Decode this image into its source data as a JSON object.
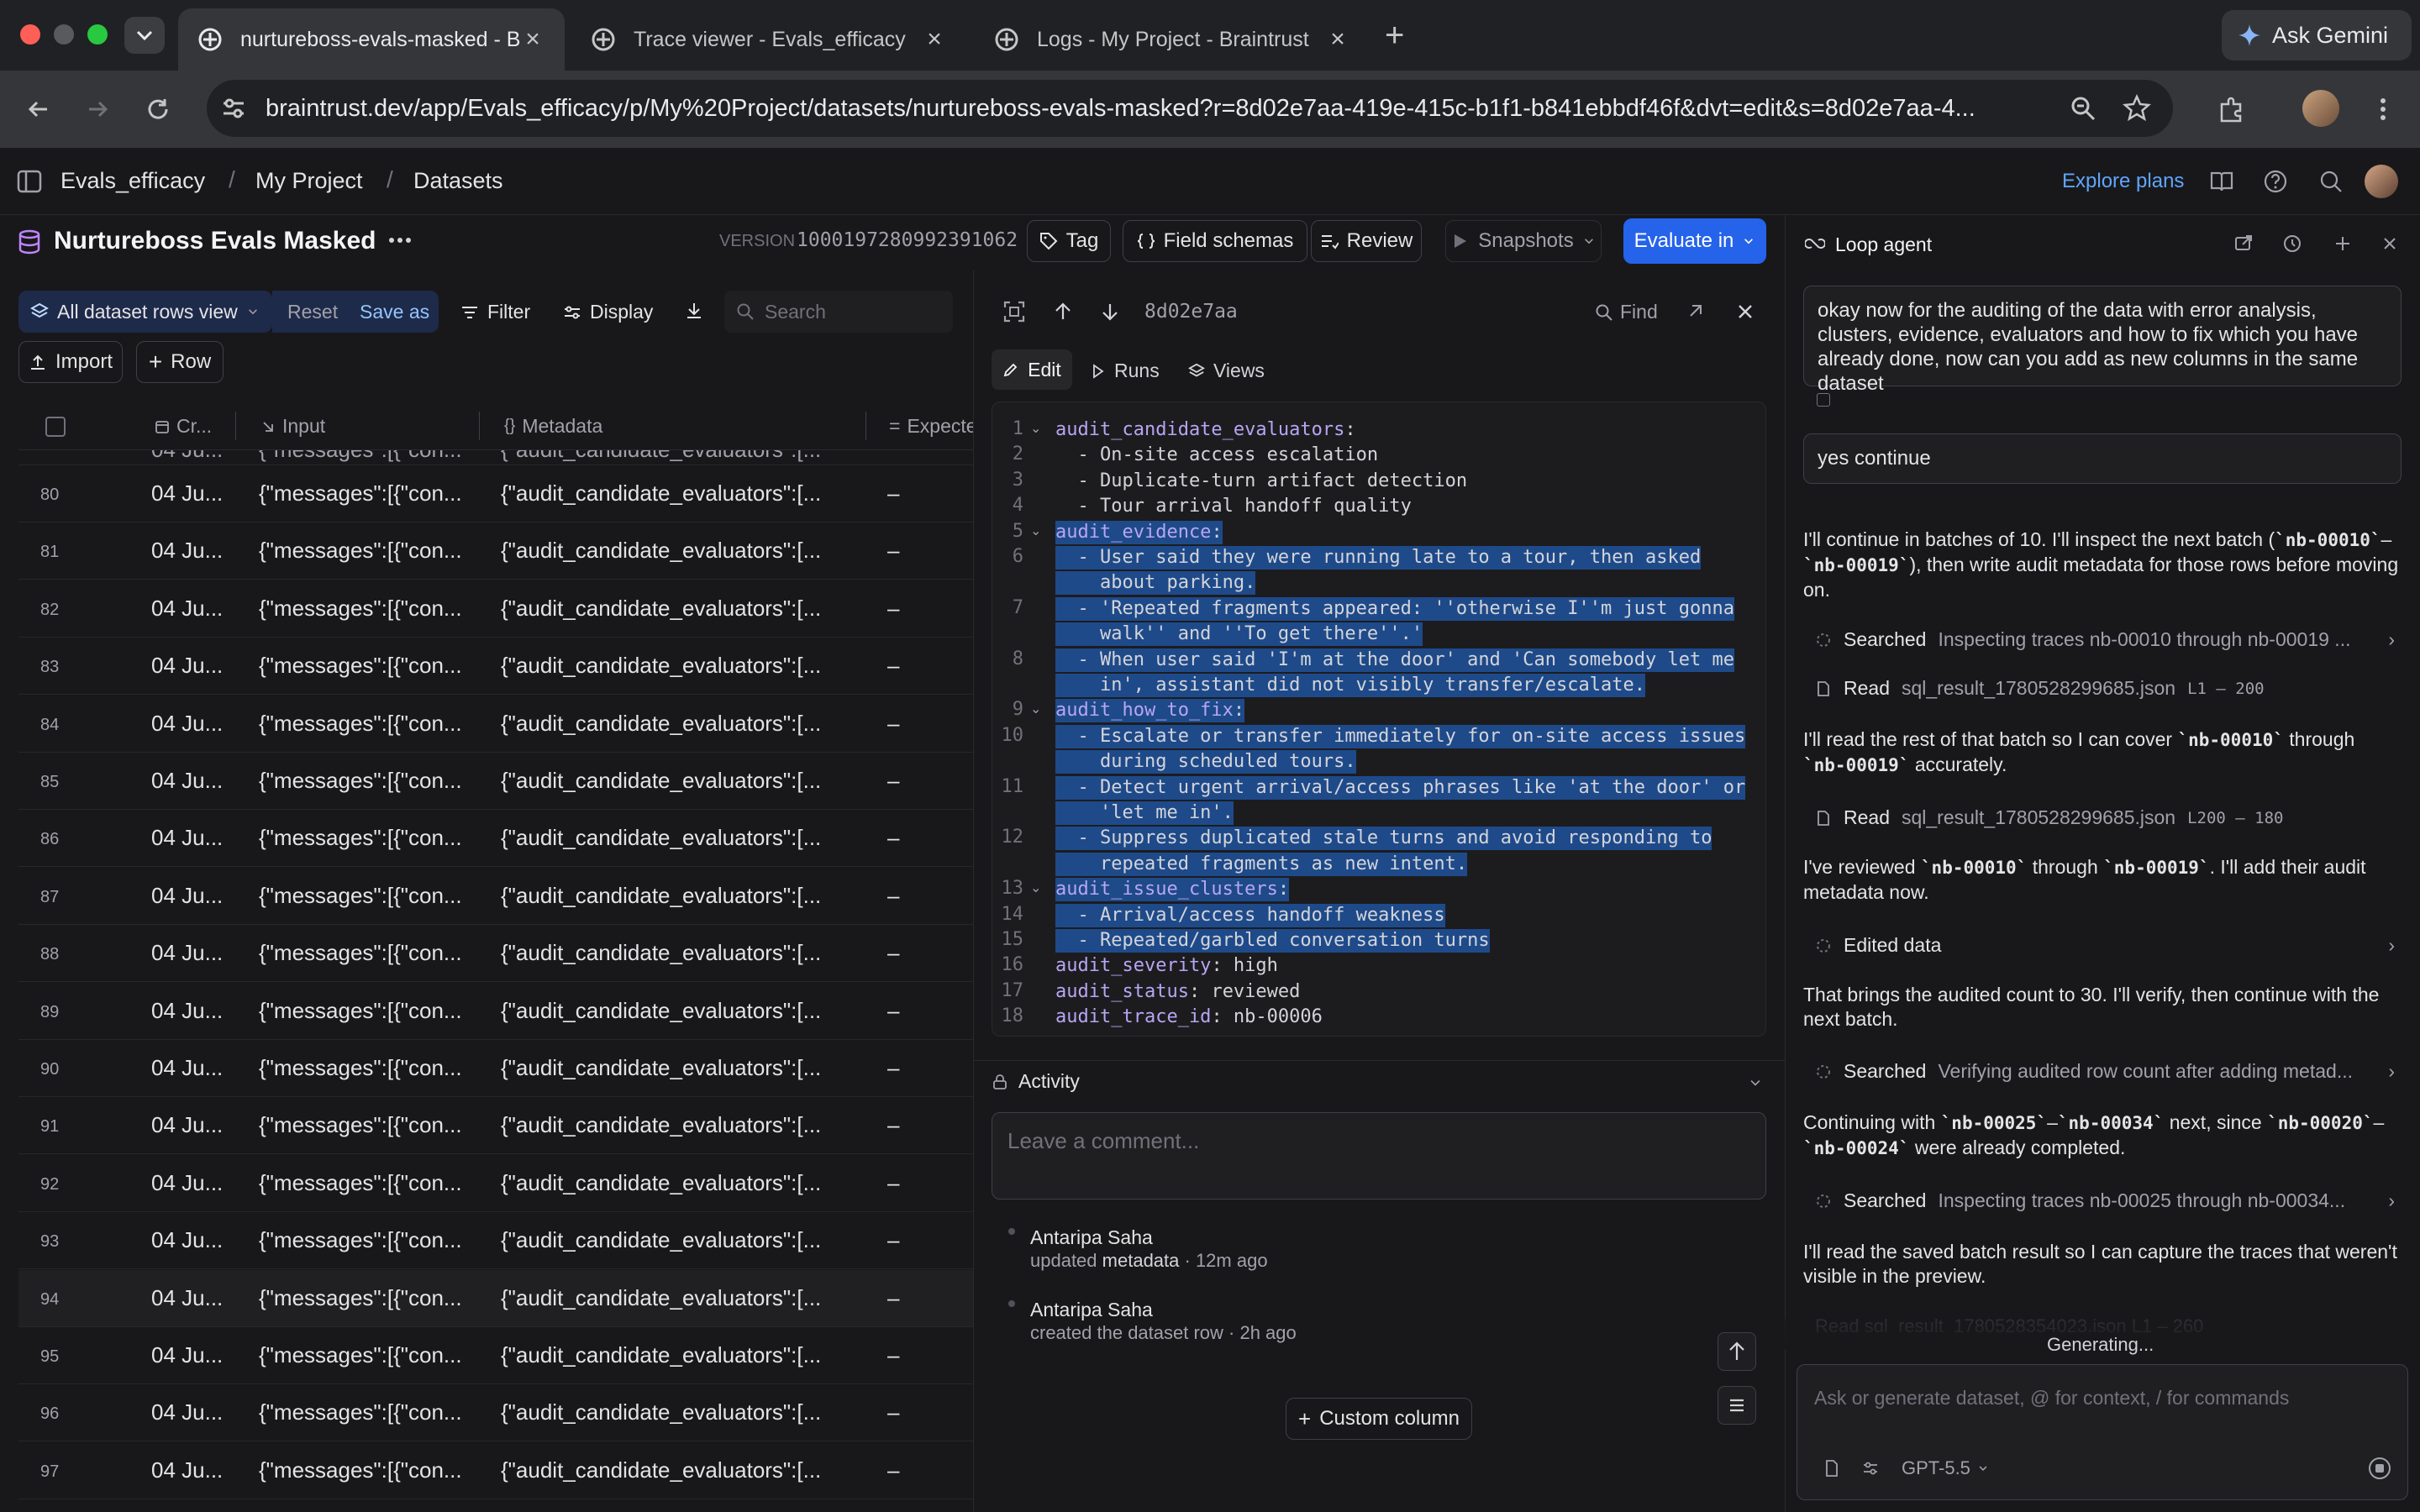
{
  "browser": {
    "tabs": [
      {
        "label": "nurtureboss-evals-masked - B",
        "active": true
      },
      {
        "label": "Trace viewer - Evals_efficacy",
        "active": false
      },
      {
        "label": "Logs - My Project - Braintrust",
        "active": false
      }
    ],
    "url": "braintrust.dev/app/Evals_efficacy/p/My%20Project/datasets/nurtureboss-evals-masked?r=8d02e7aa-419e-415c-b1f1-b841ebbdf46f&dvt=edit&s=8d02e7aa-4...",
    "gemini_label": "Ask Gemini"
  },
  "app": {
    "breadcrumbs": [
      "Evals_efficacy",
      "My Project",
      "Datasets"
    ],
    "explore_plans": "Explore plans"
  },
  "dataset": {
    "title": "Nurtureboss Evals Masked",
    "version_label": "VERSION",
    "version_value": "1000197280992391062",
    "tag_label": "Tag",
    "field_schemas_label": "Field schemas",
    "review_label": "Review",
    "snapshots_label": "Snapshots",
    "evaluate_label": "Evaluate in"
  },
  "table_toolbar": {
    "view_label": "All dataset rows view",
    "reset_label": "Reset",
    "save_as_label": "Save as",
    "filter_label": "Filter",
    "display_label": "Display",
    "search_placeholder": "Search",
    "import_label": "Import",
    "row_label": "Row"
  },
  "table": {
    "columns": [
      "Cr...",
      "Input",
      "Metadata",
      "Expecte"
    ],
    "rows": [
      {
        "num": "80",
        "created": "04 Ju...",
        "input": "{\"messages\":[{\"con...",
        "metadata": "{\"audit_candidate_evaluators\":[...",
        "expected": "–"
      },
      {
        "num": "81",
        "created": "04 Ju...",
        "input": "{\"messages\":[{\"con...",
        "metadata": "{\"audit_candidate_evaluators\":[...",
        "expected": "–"
      },
      {
        "num": "82",
        "created": "04 Ju...",
        "input": "{\"messages\":[{\"con...",
        "metadata": "{\"audit_candidate_evaluators\":[...",
        "expected": "–"
      },
      {
        "num": "83",
        "created": "04 Ju...",
        "input": "{\"messages\":[{\"con...",
        "metadata": "{\"audit_candidate_evaluators\":[...",
        "expected": "–"
      },
      {
        "num": "84",
        "created": "04 Ju...",
        "input": "{\"messages\":[{\"con...",
        "metadata": "{\"audit_candidate_evaluators\":[...",
        "expected": "–"
      },
      {
        "num": "85",
        "created": "04 Ju...",
        "input": "{\"messages\":[{\"con...",
        "metadata": "{\"audit_candidate_evaluators\":[...",
        "expected": "–"
      },
      {
        "num": "86",
        "created": "04 Ju...",
        "input": "{\"messages\":[{\"con...",
        "metadata": "{\"audit_candidate_evaluators\":[...",
        "expected": "–"
      },
      {
        "num": "87",
        "created": "04 Ju...",
        "input": "{\"messages\":[{\"con...",
        "metadata": "{\"audit_candidate_evaluators\":[...",
        "expected": "–"
      },
      {
        "num": "88",
        "created": "04 Ju...",
        "input": "{\"messages\":[{\"con...",
        "metadata": "{\"audit_candidate_evaluators\":[...",
        "expected": "–"
      },
      {
        "num": "89",
        "created": "04 Ju...",
        "input": "{\"messages\":[{\"con...",
        "metadata": "{\"audit_candidate_evaluators\":[...",
        "expected": "–"
      },
      {
        "num": "90",
        "created": "04 Ju...",
        "input": "{\"messages\":[{\"con...",
        "metadata": "{\"audit_candidate_evaluators\":[...",
        "expected": "–"
      },
      {
        "num": "91",
        "created": "04 Ju...",
        "input": "{\"messages\":[{\"con...",
        "metadata": "{\"audit_candidate_evaluators\":[...",
        "expected": "–"
      },
      {
        "num": "92",
        "created": "04 Ju...",
        "input": "{\"messages\":[{\"con...",
        "metadata": "{\"audit_candidate_evaluators\":[...",
        "expected": "–"
      },
      {
        "num": "93",
        "created": "04 Ju...",
        "input": "{\"messages\":[{\"con...",
        "metadata": "{\"audit_candidate_evaluators\":[...",
        "expected": "–"
      },
      {
        "num": "94",
        "created": "04 Ju...",
        "input": "{\"messages\":[{\"con...",
        "metadata": "{\"audit_candidate_evaluators\":[...",
        "expected": "–"
      },
      {
        "num": "95",
        "created": "04 Ju...",
        "input": "{\"messages\":[{\"con...",
        "metadata": "{\"audit_candidate_evaluators\":[...",
        "expected": "–"
      },
      {
        "num": "96",
        "created": "04 Ju...",
        "input": "{\"messages\":[{\"con...",
        "metadata": "{\"audit_candidate_evaluators\":[...",
        "expected": "–"
      },
      {
        "num": "97",
        "created": "04 Ju...",
        "input": "{\"messages\":[{\"con...",
        "metadata": "{\"audit_candidate_evaluators\":[...",
        "expected": "–"
      }
    ]
  },
  "detail": {
    "row_id": "8d02e7aa",
    "find_label": "Find",
    "tabs": [
      "Edit",
      "Runs",
      "Views"
    ],
    "code_lines": [
      {
        "n": "1",
        "text": "audit_candidate_evaluators:"
      },
      {
        "n": "2",
        "text": "  - On-site access escalation"
      },
      {
        "n": "3",
        "text": "  - Duplicate-turn artifact detection"
      },
      {
        "n": "4",
        "text": "  - Tour arrival handoff quality"
      },
      {
        "n": "5",
        "text": "audit_evidence:"
      },
      {
        "n": "6",
        "text": "  - User said they were running late to a tour, then asked"
      },
      {
        "n": "",
        "text": "    about parking."
      },
      {
        "n": "7",
        "text": "  - 'Repeated fragments appeared: ''otherwise I''m just gonna"
      },
      {
        "n": "",
        "text": "    walk'' and ''To get there''.'"
      },
      {
        "n": "8",
        "text": "  - When user said 'I'm at the door' and 'Can somebody let me"
      },
      {
        "n": "",
        "text": "    in', assistant did not visibly transfer/escalate."
      },
      {
        "n": "9",
        "text": "audit_how_to_fix:"
      },
      {
        "n": "10",
        "text": "  - Escalate or transfer immediately for on-site access issues"
      },
      {
        "n": "",
        "text": "    during scheduled tours."
      },
      {
        "n": "11",
        "text": "  - Detect urgent arrival/access phrases like 'at the door' or"
      },
      {
        "n": "",
        "text": "    'let me in'."
      },
      {
        "n": "12",
        "text": "  - Suppress duplicated stale turns and avoid responding to"
      },
      {
        "n": "",
        "text": "    repeated fragments as new intent."
      },
      {
        "n": "13",
        "text": "audit_issue_clusters:"
      },
      {
        "n": "14",
        "text": "  - Arrival/access handoff weakness"
      },
      {
        "n": "15",
        "text": "  - Repeated/garbled conversation turns"
      },
      {
        "n": "16",
        "text": "audit_severity: high"
      },
      {
        "n": "17",
        "text": "audit_status: reviewed"
      },
      {
        "n": "18",
        "text": "audit_trace_id: nb-00006"
      }
    ],
    "activity_label": "Activity",
    "comment_placeholder": "Leave a comment...",
    "activity": [
      {
        "author": "Antaripa Saha",
        "action": "updated",
        "target": "metadata",
        "time": " · 12m ago"
      },
      {
        "author": "Antaripa Saha",
        "action": "created the dataset row",
        "target": "",
        "time": " · 2h ago"
      }
    ],
    "custom_column_label": "Custom column"
  },
  "agent": {
    "title": "Loop agent",
    "user_msg_1": "okay now for the auditing of the data with error analysis, clusters, evidence,  evaluators and how to fix which you have already done, now can you add as new columns in the same dataset",
    "user_msg_2": "yes continue",
    "p1_a": "I'll continue in batches of 10. I'll inspect the next batch (",
    "p1_b": "`nb-00010`",
    "p1_c": "–",
    "p1_d": "`nb-00019`",
    "p1_e": "), then write audit metadata for those rows before moving on.",
    "tool1_label": "Searched",
    "tool1_detail": "Inspecting traces nb-00010 through nb-00019 ...",
    "tool2_label": "Read",
    "tool2_file": "sql_result_1780528299685.json",
    "tool2_range": "L1 – 200",
    "p2_a": "I'll read the rest of that batch so I can cover ",
    "p2_b": "`nb-00010`",
    "p2_c": " through ",
    "p2_d": "`nb-00019`",
    "p2_e": " accurately.",
    "tool3_label": "Read",
    "tool3_file": "sql_result_1780528299685.json",
    "tool3_range": "L200 – 180",
    "p3_a": "I've reviewed ",
    "p3_b": "`nb-00010`",
    "p3_c": " through ",
    "p3_d": "`nb-00019`",
    "p3_e": ". I'll add their audit metadata now.",
    "tool4_label": "Edited data",
    "p4": "That brings the audited count to 30. I'll verify, then continue with the next batch.",
    "tool5_label": "Searched",
    "tool5_detail": "Verifying audited row count after adding metad...",
    "p5_a": "Continuing with ",
    "p5_b": "`nb-00025`",
    "p5_c": "–",
    "p5_d": "`nb-00034`",
    "p5_e": " next, since ",
    "p5_f": "`nb-00020`",
    "p5_g": "–",
    "p5_h": "`nb-00024`",
    "p5_i": " were already completed.",
    "tool6_label": "Searched",
    "tool6_detail": "Inspecting traces nb-00025 through nb-00034...",
    "p6": "I'll read the saved batch result so I can capture the traces that weren't visible in the preview.",
    "tool7_partial": "Read  sql_result_1780528354023.json  L1 – 260",
    "generating": "Generating...",
    "input_placeholder": "Ask or generate dataset, @ for context, / for commands",
    "model_label": "GPT-5.5"
  },
  "colors": {
    "accent": "#2563eb",
    "selection": "#1e4a8a",
    "key": "#b8a6f2"
  }
}
